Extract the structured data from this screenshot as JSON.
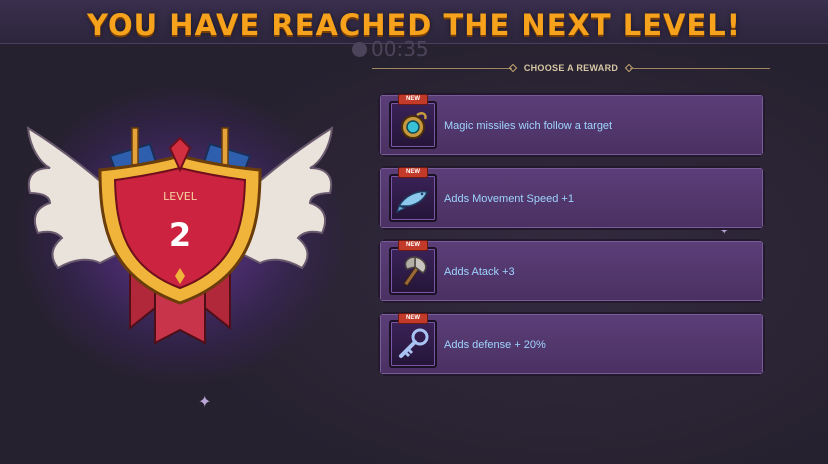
{
  "title": "YOU HAVE REACHED THE NEXT LEVEL!",
  "timer": "00:35",
  "reward_header": "CHOOSE A REWARD",
  "level": {
    "label": "LEVEL",
    "value": "2"
  },
  "rewards": [
    {
      "badge": "NEW",
      "icon": "amulet-icon",
      "text": "Magic missiles wich follow a target"
    },
    {
      "badge": "NEW",
      "icon": "fish-icon",
      "text": "Adds Movement Speed +1"
    },
    {
      "badge": "NEW",
      "icon": "axe-icon",
      "text": "Adds Atack +3"
    },
    {
      "badge": "NEW",
      "icon": "key-icon",
      "text": "Adds defense + 20%"
    }
  ],
  "colors": {
    "title": "#f6a21c",
    "reward_text": "#9fd4ff",
    "card": "#5b3e78",
    "badge": "#c13a2a"
  }
}
